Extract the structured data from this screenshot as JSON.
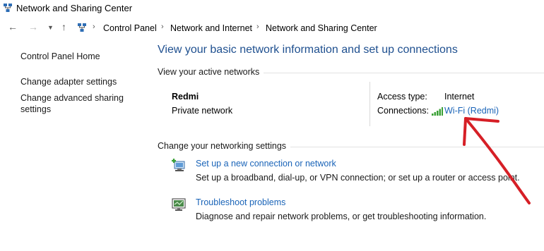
{
  "window": {
    "title": "Network and Sharing Center"
  },
  "nav": {
    "back_icon": "back-arrow-icon",
    "forward_icon": "forward-arrow-icon",
    "recent_icon": "chevron-down-icon",
    "up_icon": "up-arrow-icon",
    "breadcrumb": [
      "Control Panel",
      "Network and Internet",
      "Network and Sharing Center"
    ]
  },
  "sidebar": {
    "items": [
      {
        "label": "Control Panel Home"
      },
      {
        "label": "Change adapter settings"
      },
      {
        "label": "Change advanced sharing settings"
      }
    ]
  },
  "main": {
    "heading": "View your basic network information and set up connections",
    "active_networks_title": "View your active networks",
    "network": {
      "name": "Redmi",
      "type": "Private network",
      "access_type_label": "Access type:",
      "access_type_value": "Internet",
      "connections_label": "Connections:",
      "connection_link": "Wi-Fi (Redmi)"
    },
    "settings_title": "Change your networking settings",
    "tasks": [
      {
        "link": "Set up a new connection or network",
        "description": "Set up a broadband, dial-up, or VPN connection; or set up a router or access point.",
        "icon": "new-connection-icon"
      },
      {
        "link": "Troubleshoot problems",
        "description": "Diagnose and repair network problems, or get troubleshooting information.",
        "icon": "troubleshoot-icon"
      }
    ]
  },
  "colors": {
    "heading": "#1e4f8f",
    "link": "#1a64b8",
    "annotation": "#d61f26"
  }
}
